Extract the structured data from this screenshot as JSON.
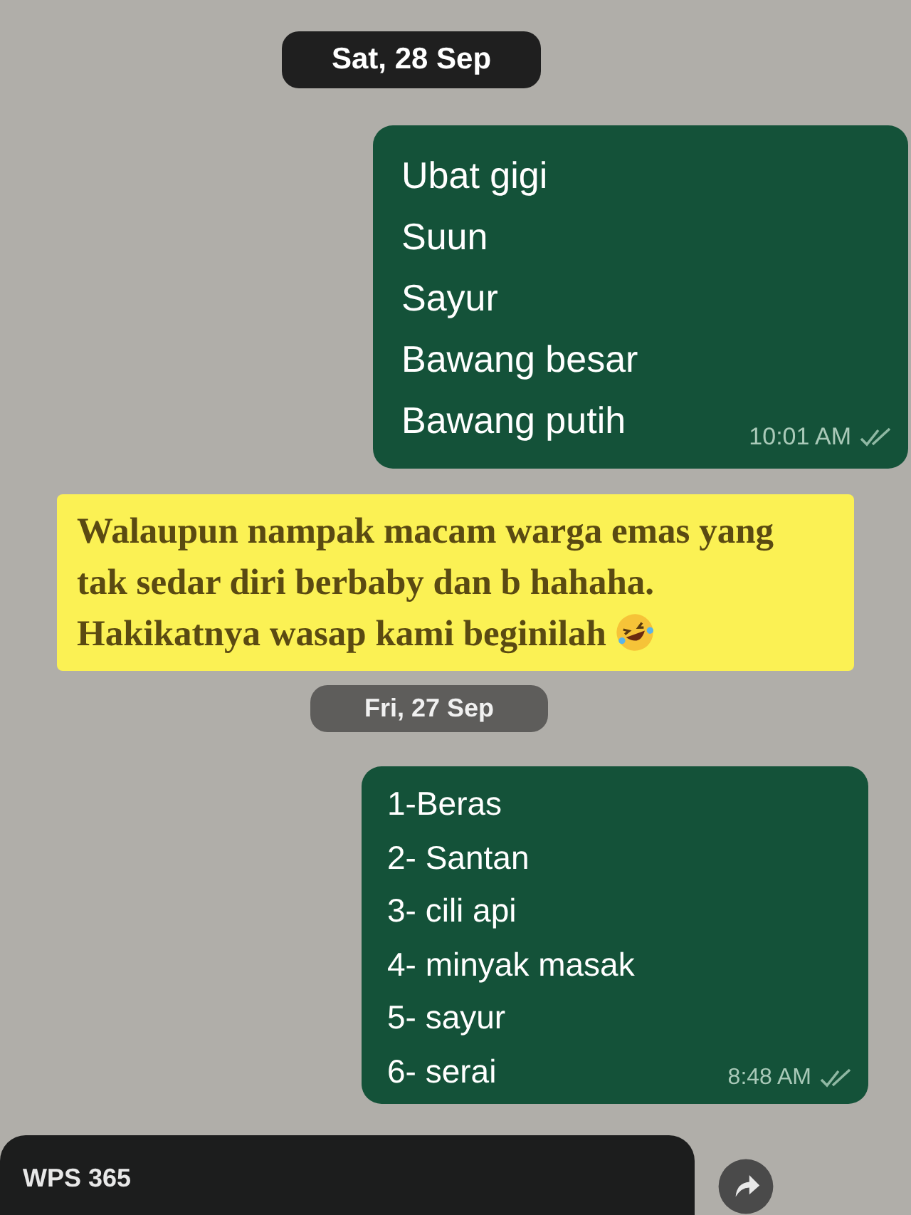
{
  "sections": [
    {
      "date": "Sat, 28 Sep",
      "message": {
        "lines": [
          "Ubat gigi",
          "Suun",
          "Sayur",
          "Bawang besar",
          "Bawang putih"
        ],
        "time": "10:01 AM"
      }
    },
    {
      "date": "Fri, 27 Sep",
      "message": {
        "lines": [
          "1-Beras",
          "2- Santan",
          "3- cili api",
          "4- minyak masak",
          "5- sayur",
          "6- serai"
        ],
        "time": "8:48 AM"
      }
    }
  ],
  "caption": "Walaupun nampak macam warga emas yang tak sedar diri berbaby dan b hahaha. Hakikatnya wasap kami beginilah",
  "bottom_bar": {
    "title": "WPS 365"
  }
}
